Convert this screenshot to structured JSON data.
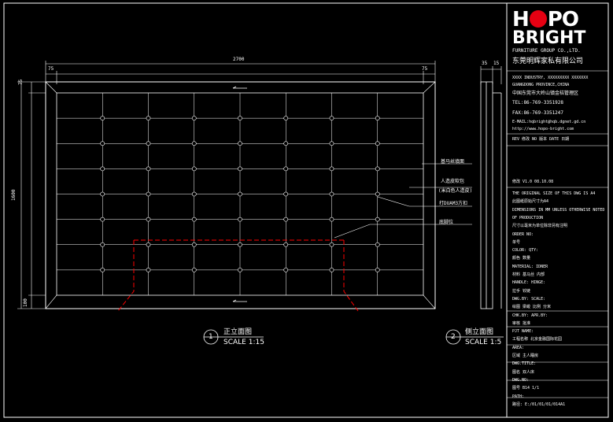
{
  "logo": {
    "brand_top": "H  PO",
    "brand_bottom": "BRIGHT",
    "company_en": "FURNITURE GROUP CO.,LTD.",
    "company_cn": "东莞明辉家私有限公司"
  },
  "company_info": {
    "addr_en1": "XXXX INDUSTRY, XXXXXXXXX XXXXXXX",
    "addr_en2": "GUANGDONG PROVINCE,CHINA",
    "addr_cn": "中国东莞市大岭山镇金桔管理区",
    "tel": "TEL:86-769-3351928",
    "fax": "FAX:86-769-3351247",
    "email": "E-MAIL:hqbright@hqb.dgnet.gd.cn",
    "web": "http://www.hopo-bright.com"
  },
  "revision": {
    "header": "REV  修改   NO 版本    DATE 日期",
    "row": "修改      V1.0   08.10.08"
  },
  "title_block": [
    "THE ORIGINAL SIZE OF THIS DWG IS A4",
    "此图纸原始尺寸为A4",
    "DIMENSIONS IN MM UNLESS OTHERWISE NOTED",
    "OF PRODUCTION",
    "尺寸以毫米为单位除非另有注明",
    "ORDER NO:",
    "单号",
    "COLOR:      QTY:",
    "颜色        数量",
    "MATERIAL:   IDNER",
    "材料   基马丝   内部",
    "HANDLE:     HINGE:",
    "拉手        铰链",
    "DWG.BY:     SCALE:",
    "绘图   梁峻   比例  分米",
    "CHK.BY:     APR.BY:",
    "审核        批准",
    "PJT NAME:",
    "工程名称   北京金融国际花园",
    "AREA:",
    "区域        主人睡房",
    "DWG.TITLE:",
    "图名        双人床",
    "DWG.NO:",
    "图号        B14    1/1",
    "PATH:",
    "路径:  E:/01/01/01/014A1"
  ],
  "dimensions": {
    "total_width": "2700",
    "left_margin": "75",
    "right_margin": "75",
    "side_a": "35",
    "side_b": "15",
    "top_margin": "75",
    "height": "1600",
    "bottom": "100"
  },
  "annotations": {
    "a1": "基马丝填面",
    "a2": "人造皮软包",
    "a3": "(米白色人造皮)",
    "a4": "打DUAM3方扣",
    "a5": "底脚位"
  },
  "views": {
    "front_number": "1",
    "front_title": "正立面图",
    "front_scale": "SCALE 1:15",
    "side_number": "2",
    "side_title": "侧立面图",
    "side_scale": "SCALE 1:5"
  },
  "colors": {
    "background": "#000000",
    "line": "#ffffff",
    "accent": "#e60012",
    "cutout": "#ff0000"
  }
}
